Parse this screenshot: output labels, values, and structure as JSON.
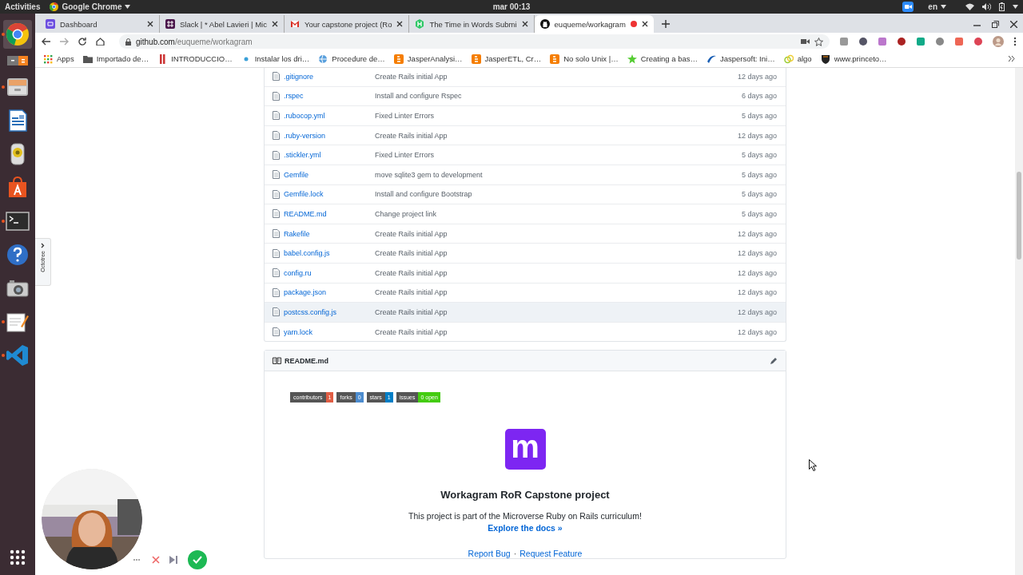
{
  "system_bar": {
    "activities": "Activities",
    "app_menu": "Google Chrome",
    "clock": "mar 00:13",
    "language": "en"
  },
  "dock": {
    "items": [
      {
        "kind": "chrome",
        "running": true,
        "selected": true
      },
      {
        "kind": "calculator",
        "running": false,
        "selected": false
      },
      {
        "kind": "files",
        "running": true,
        "selected": false
      },
      {
        "kind": "writer",
        "running": false,
        "selected": false
      },
      {
        "kind": "music",
        "running": false,
        "selected": false
      },
      {
        "kind": "software",
        "running": false,
        "selected": false
      },
      {
        "kind": "terminal",
        "running": true,
        "selected": false
      },
      {
        "kind": "help",
        "running": false,
        "selected": false
      },
      {
        "kind": "camera",
        "running": false,
        "selected": false
      },
      {
        "kind": "editor",
        "running": true,
        "selected": false
      },
      {
        "kind": "vscode",
        "running": true,
        "selected": false
      }
    ]
  },
  "browser": {
    "tabs": [
      {
        "kind": "dashboard",
        "title": "Dashboard",
        "selected": false
      },
      {
        "kind": "slack",
        "title": "Slack | * Abel Lavieri | Mic",
        "selected": false
      },
      {
        "kind": "gmail",
        "title": "Your capstone project (Ro",
        "selected": false
      },
      {
        "kind": "hackerrank",
        "title": "The Time in Words Submi",
        "selected": false
      },
      {
        "kind": "github",
        "title": "euqueme/workagram",
        "selected": true
      }
    ],
    "address": {
      "host": "github.com",
      "path": "/euqueme/workagram"
    },
    "bookmarks": [
      {
        "kind": "apps",
        "title": "Apps"
      },
      {
        "kind": "folder",
        "title": "Importado de…"
      },
      {
        "kind": "bars",
        "title": "INTRODUCCIO…"
      },
      {
        "kind": "dot",
        "title": "Instalar los dri…"
      },
      {
        "kind": "globe",
        "title": "Procedure de…"
      },
      {
        "kind": "blogger",
        "title": "JasperAnalysi…"
      },
      {
        "kind": "blogger",
        "title": "JasperETL, Cr…"
      },
      {
        "kind": "blogger",
        "title": "No solo Unix |…"
      },
      {
        "kind": "star",
        "title": "Creating a bas…"
      },
      {
        "kind": "swoosh",
        "title": "Jaspersoft: Ini…"
      },
      {
        "kind": "rings",
        "title": "algo"
      },
      {
        "kind": "shield",
        "title": "www.princeto…"
      }
    ]
  },
  "octotree": {
    "label": "Octotree"
  },
  "files": [
    {
      "name": ".gitignore",
      "message": "Create Rails initial App",
      "age": "12 days ago",
      "highlighted": false
    },
    {
      "name": ".rspec",
      "message": "Install and configure Rspec",
      "age": "6 days ago",
      "highlighted": false
    },
    {
      "name": ".rubocop.yml",
      "message": "Fixed Linter Errors",
      "age": "5 days ago",
      "highlighted": false
    },
    {
      "name": ".ruby-version",
      "message": "Create Rails initial App",
      "age": "12 days ago",
      "highlighted": false
    },
    {
      "name": ".stickler.yml",
      "message": "Fixed Linter Errors",
      "age": "5 days ago",
      "highlighted": false
    },
    {
      "name": "Gemfile",
      "message": "move sqlite3 gem to development",
      "age": "5 days ago",
      "highlighted": false
    },
    {
      "name": "Gemfile.lock",
      "message": "Install and configure Bootstrap",
      "age": "5 days ago",
      "highlighted": false
    },
    {
      "name": "README.md",
      "message": "Change project link",
      "age": "5 days ago",
      "highlighted": false
    },
    {
      "name": "Rakefile",
      "message": "Create Rails initial App",
      "age": "12 days ago",
      "highlighted": false
    },
    {
      "name": "babel.config.js",
      "message": "Create Rails initial App",
      "age": "12 days ago",
      "highlighted": false
    },
    {
      "name": "config.ru",
      "message": "Create Rails initial App",
      "age": "12 days ago",
      "highlighted": false
    },
    {
      "name": "package.json",
      "message": "Create Rails initial App",
      "age": "12 days ago",
      "highlighted": false
    },
    {
      "name": "postcss.config.js",
      "message": "Create Rails initial App",
      "age": "12 days ago",
      "highlighted": true
    },
    {
      "name": "yarn.lock",
      "message": "Create Rails initial App",
      "age": "12 days ago",
      "highlighted": false
    }
  ],
  "readme": {
    "filename": "README.md",
    "badges": [
      {
        "label": "contributors",
        "value": "1",
        "color": "#e05d44"
      },
      {
        "label": "forks",
        "value": "0",
        "color": "#4c8ccf"
      },
      {
        "label": "stars",
        "value": "1",
        "color": "#007ec6"
      },
      {
        "label": "issues",
        "value": "0 open",
        "color": "#4c1"
      }
    ],
    "logo_letter": "m",
    "title": "Workagram RoR Capstone project",
    "description": "This project is part of the Microverse Ruby on Rails curriculum!",
    "docs_link": "Explore the docs »",
    "links": [
      "Report Bug",
      "Request Feature"
    ],
    "separator": "·"
  }
}
